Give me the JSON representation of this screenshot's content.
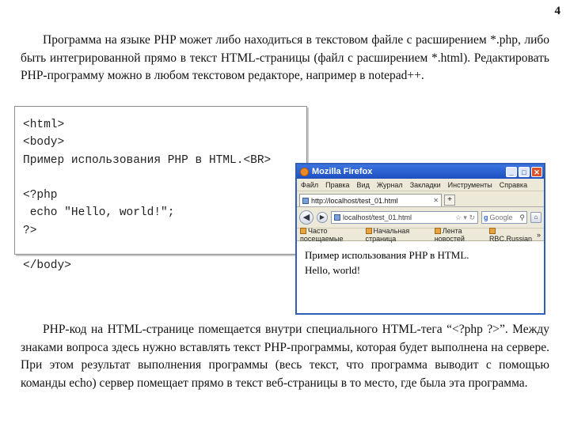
{
  "page_number": "4",
  "paragraph1": "Программа на языке PHP может либо находиться в текстовом файле с расширением *.php, либо быть интегрированной прямо в текст HTML-страницы (файл с расширением *.html). Редактировать PHP-программу можно в любом текстовом редакторе, например в notepad++.",
  "code_listing": "<html>\n<body>\nПример использования PHP в HTML.<BR>\n\n<?php\n echo \"Hello, world!\";\n?>\n\n</body>",
  "browser": {
    "title": "Mozilla Firefox",
    "menu": [
      "Файл",
      "Правка",
      "Вид",
      "Журнал",
      "Закладки",
      "Инструменты",
      "Справка"
    ],
    "tab_label": "http://localhost/test_01.html",
    "new_tab": "+",
    "url": "localhost/test_01.html",
    "search_engine": "Google",
    "bookmarks": [
      "Часто посещаемые",
      "Начальная страница",
      "Лента новостей",
      "RBC.Russian"
    ],
    "content_line1": "Пример использования PHP в HTML.",
    "content_line2": "Hello, world!"
  },
  "paragraph2": "PHP-код на HTML-странице помещается внутри специального HTML-тега “<?php ?>”. Между знаками вопроса здесь нужно вставлять текст PHP-программы, которая будет выполнена на сервере. При этом результат выполнения программы (весь текст, что программа выводит с помощью команды echo) сервер помещает прямо в текст веб-страницы в то место, где была эта программа."
}
